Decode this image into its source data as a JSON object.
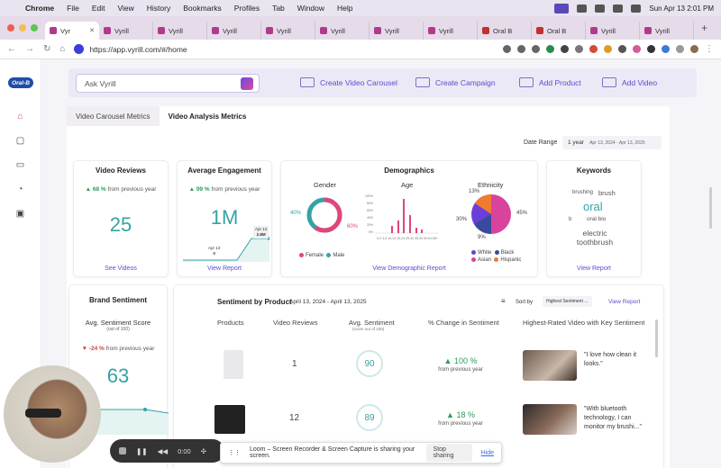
{
  "menubar": {
    "app": "Chrome",
    "items": [
      "File",
      "Edit",
      "View",
      "History",
      "Bookmarks",
      "Profiles",
      "Tab",
      "Window",
      "Help"
    ],
    "clock": "Sun Apr 13  2:01 PM"
  },
  "tabs": [
    {
      "label": "Vyr",
      "active": true
    },
    {
      "label": "Vyrill"
    },
    {
      "label": "Vyrill"
    },
    {
      "label": "Vyrill"
    },
    {
      "label": "Vyrill"
    },
    {
      "label": "Vyrill"
    },
    {
      "label": "Vyrill"
    },
    {
      "label": "Vyrill"
    },
    {
      "label": "Oral B"
    },
    {
      "label": "Oral B"
    },
    {
      "label": "Vyrill"
    },
    {
      "label": "Vyrill"
    }
  ],
  "address": {
    "url": "https://app.vyrill.com/#/home"
  },
  "brand_logo": "Oral-B",
  "actionbar": {
    "ask_placeholder": "Ask Vyrill",
    "create_carousel": "Create Video Carousel",
    "create_campaign": "Create Campaign",
    "add_product": "Add Product",
    "add_video": "Add Video"
  },
  "seg_tabs": [
    "Video Carousel Metrics",
    "Video Analysis Metrics"
  ],
  "date_range": {
    "label": "Date Range",
    "value": "1 year",
    "detail": "Apr 13, 2024 - Apr 13, 2025"
  },
  "video_reviews": {
    "title": "Video Reviews",
    "change": "68 %",
    "change_text": "from previous year",
    "value": "25",
    "link": "See Videos"
  },
  "engagement": {
    "title": "Average Engagement",
    "change": "99 %",
    "change_text": "from previous year",
    "value": "1M",
    "tag_date_a": "Apr 13",
    "tag_val_a": "2.8M",
    "tag_date_b": "Apr 13",
    "tag_val_b": "0",
    "link": "View Report"
  },
  "demographics": {
    "title": "Demographics",
    "gender_title": "Gender",
    "female_pct": "40%",
    "male_pct": "60%",
    "female": "Female",
    "male": "Male",
    "age_title": "Age",
    "age_ticks": [
      "0-2",
      "3-9",
      "10-14",
      "15-24",
      "25-34",
      "35-49",
      "50-64",
      "65+"
    ],
    "age_ylabels": [
      "100%",
      "80%",
      "60%",
      "40%",
      "20%",
      "0%"
    ],
    "ethnicity_title": "Ethnicity",
    "eth_13": "13%",
    "eth_45": "45%",
    "eth_30": "30%",
    "eth_9": "9%",
    "eth_legend": [
      "White",
      "Black",
      "Asian",
      "Hispanic"
    ],
    "link": "View Demographic Report"
  },
  "keywords": {
    "title": "Keywords",
    "words": [
      "brushing",
      "brush",
      "oral",
      "b",
      "oral bio",
      "electric",
      "toothbrush"
    ],
    "link": "View Report"
  },
  "brand_sentiment": {
    "title": "Brand Sentiment",
    "subtitle": "Avg. Sentiment Score",
    "subtitle2": "(out of 100)",
    "change": "-24 %",
    "change_text": "from previous year",
    "value": "63"
  },
  "sentiment_by_product": {
    "title": "Sentiment by Product",
    "range": "April 13, 2024 - April 13, 2025",
    "sort_label": "Sort by",
    "sort_value": "Highest Sentiment ...",
    "link": "View Report",
    "headers": [
      "Products",
      "Video Reviews",
      "Avg. Sentiment",
      "(score out of 100)",
      "% Change in Sentiment",
      "Highest-Rated Video with Key Sentiment"
    ],
    "rows": [
      {
        "reviews": "1",
        "sentiment": "90",
        "change": "100 %",
        "change_text": "from previous year",
        "quote": "\"I love how clean it looks.\""
      },
      {
        "reviews": "12",
        "sentiment": "89",
        "change": "18 %",
        "change_text": "from previous year",
        "quote": "\"With bluetooth technology, I can monitor my brushi...\""
      }
    ]
  },
  "player": {
    "time": "0:00"
  },
  "loom": {
    "message": "Loom – Screen Recorder & Screen Capture is sharing your screen.",
    "stop": "Stop sharing",
    "hide": "Hide"
  },
  "colors": {
    "accent": "#5a4ccf",
    "teal": "#34a3a5",
    "female": "#e0457b",
    "male": "#34a3a5"
  }
}
